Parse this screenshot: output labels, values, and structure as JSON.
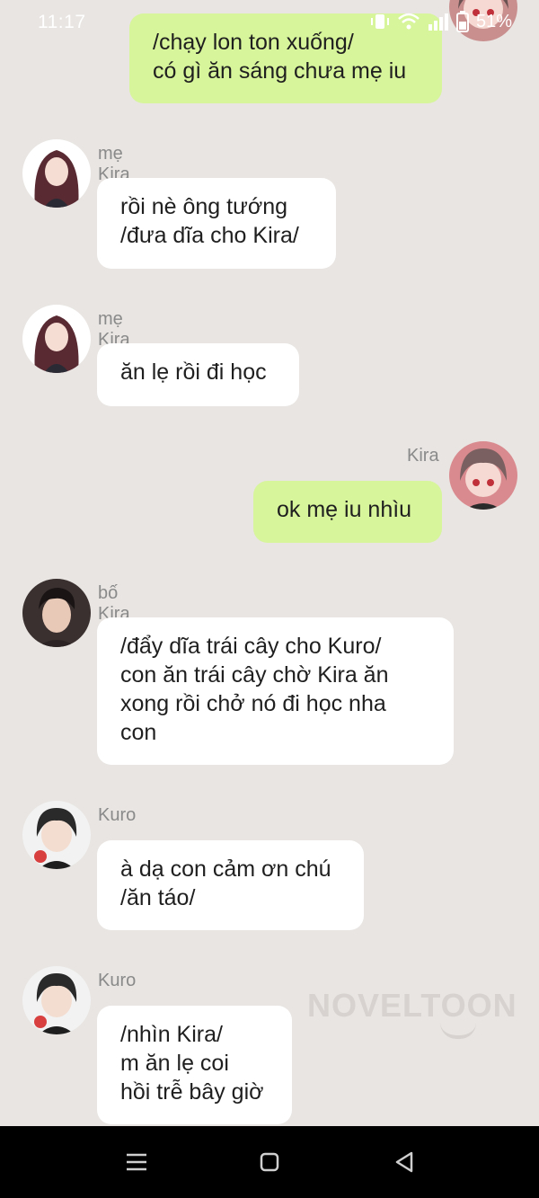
{
  "status_bar": {
    "time": "11:17",
    "battery": "51%",
    "icons": [
      "vibrate-icon",
      "wifi-icon",
      "signal-icon",
      "battery-icon"
    ]
  },
  "messages": [
    {
      "id": "m0",
      "side": "out",
      "sender": "",
      "text": "/chạy lon ton xuống/\ncó gì ăn sáng chưa mẹ iu",
      "avatar": "kira-avatar"
    },
    {
      "id": "m1",
      "side": "in",
      "sender": "mẹ Kira",
      "text": "rồi nè ông tướng\n/đưa dĩa cho Kira/",
      "avatar": "mother-avatar"
    },
    {
      "id": "m2",
      "side": "in",
      "sender": "mẹ Kira",
      "text": "ăn lẹ rồi đi học",
      "avatar": "mother-avatar"
    },
    {
      "id": "m3",
      "side": "out",
      "sender": "Kira",
      "text": "ok mẹ iu nhìu",
      "avatar": "kira-avatar"
    },
    {
      "id": "m4",
      "side": "in",
      "sender": "bố Kira",
      "text": "/đẩy dĩa trái cây cho Kuro/\ncon ăn trái cây chờ Kira ăn\nxong rồi chở nó đi học nha\ncon",
      "avatar": "father-avatar"
    },
    {
      "id": "m5",
      "side": "in",
      "sender": "Kuro",
      "text": "à dạ con cảm ơn chú\n/ăn táo/",
      "avatar": "kuro-avatar"
    },
    {
      "id": "m6",
      "side": "in",
      "sender": "Kuro",
      "text": "/nhìn Kira/\nm ăn lẹ coi\nhồi trễ bây giờ",
      "avatar": "kuro-avatar"
    }
  ],
  "watermark": "NOVELTOON",
  "nav_bar": {
    "buttons": [
      "menu-icon",
      "home-icon",
      "back-icon"
    ]
  },
  "colors": {
    "background": "#e8e5e2",
    "incoming_bubble": "#ffffff",
    "outgoing_bubble": "#d7f59a",
    "name_text": "#8a8a8a"
  }
}
